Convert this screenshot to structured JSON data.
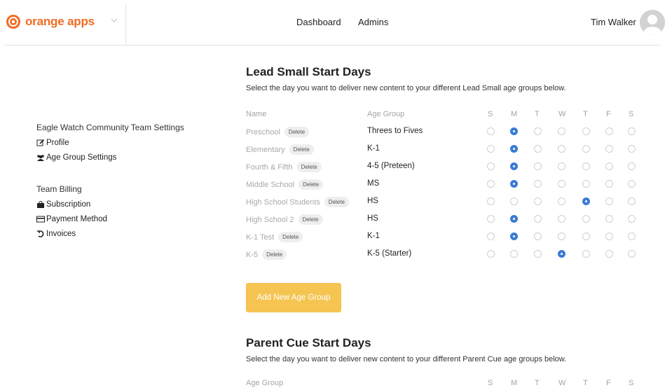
{
  "brand": {
    "name": "orange apps",
    "accent": "#f26a21"
  },
  "nav": {
    "dashboard": "Dashboard",
    "admins": "Admins"
  },
  "user": {
    "name": "Tim Walker"
  },
  "sidebar": {
    "team_heading": "Eagle Watch Community Team Settings",
    "profile": "Profile",
    "age_group_settings": "Age Group Settings",
    "billing_heading": "Team Billing",
    "subscription": "Subscription",
    "payment_method": "Payment Method",
    "invoices": "Invoices"
  },
  "lead_small": {
    "title": "Lead Small Start Days",
    "subtitle": "Select the day you want to deliver new content to your different Lead Small age groups below.",
    "col_name": "Name",
    "col_age_group": "Age Group",
    "days": [
      "S",
      "M",
      "T",
      "W",
      "T",
      "F",
      "S"
    ],
    "delete_label": "Delete",
    "rows": [
      {
        "name": "Preschool",
        "age_group": "Threes to Fives",
        "selected_day": 1
      },
      {
        "name": "Elementary",
        "age_group": "K-1",
        "selected_day": 1
      },
      {
        "name": "Fourth & Fifth",
        "age_group": "4-5 (Preteen)",
        "selected_day": 1
      },
      {
        "name": "Middle School",
        "age_group": "MS",
        "selected_day": 1
      },
      {
        "name": "High School Students",
        "age_group": "HS",
        "selected_day": 4
      },
      {
        "name": "High School 2",
        "age_group": "HS",
        "selected_day": 1
      },
      {
        "name": "K-1 Test",
        "age_group": "K-1",
        "selected_day": 1
      },
      {
        "name": "K-5",
        "age_group": "K-5 (Starter)",
        "selected_day": 3
      }
    ],
    "add_button": "Add New Age Group"
  },
  "parent_cue": {
    "title": "Parent Cue Start Days",
    "subtitle": "Select the day you want to deliver new content to your different Parent Cue age groups below.",
    "col_age_group": "Age Group",
    "days": [
      "S",
      "M",
      "T",
      "W",
      "T",
      "F",
      "S"
    ]
  },
  "colors": {
    "radio_selected": "#3a7bd5",
    "add_button": "#f5c451"
  }
}
